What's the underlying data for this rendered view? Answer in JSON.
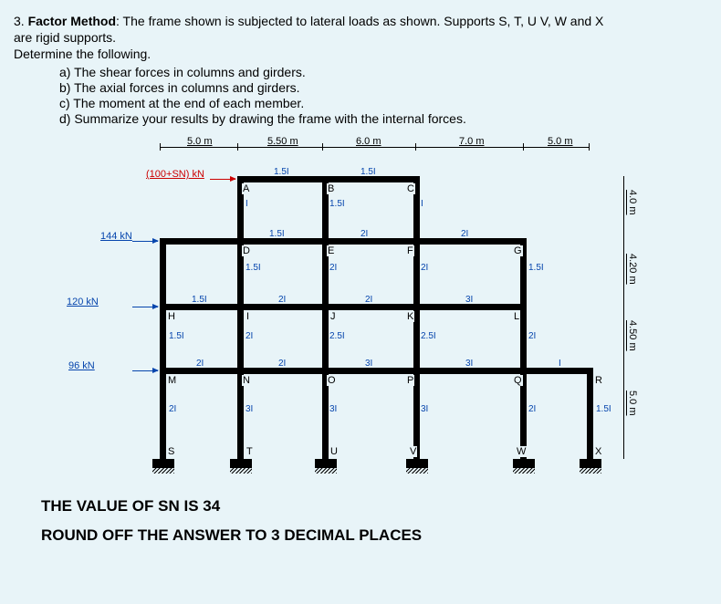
{
  "problem": {
    "number": "3.",
    "method": "Factor Method",
    "description": ": The frame shown is subjected to lateral loads as shown. Supports S, T, U V, W and X",
    "line2": "are rigid supports.",
    "line3": "Determine the following.",
    "items": {
      "a": "a)   The shear forces in columns and girders.",
      "b": "b)   The axial forces in columns and girders.",
      "c": "c)   The moment at the end of each member.",
      "d": "d)   Summarize your results by drawing the frame with the internal forces."
    }
  },
  "dims_top": {
    "d1": "5.0 m",
    "d2": "5.50 m",
    "d3": "6.0 m",
    "d4": "7.0 m",
    "d5": "5.0 m"
  },
  "dims_right": {
    "h1": "4.0 m",
    "h2": "4.20 m",
    "h3": "4.50 m",
    "h4": "5.0 m"
  },
  "loads": {
    "L1": "(100+SN) kN",
    "L2": "144 kN",
    "L3": "120 kN",
    "L4": "96 kN"
  },
  "nodes": {
    "A": "A",
    "B": "B",
    "C": "C",
    "D": "D",
    "E": "E",
    "F": "F",
    "G": "G",
    "H": "H",
    "I": "I",
    "J": "J",
    "K": "K",
    "L": "L",
    "M": "M",
    "N": "N",
    "O": "O",
    "P": "P",
    "Q": "Q",
    "R": "R",
    "S": "S",
    "T": "T",
    "U": "U",
    "V": "V",
    "W": "W",
    "X": "X"
  },
  "col_vals": {
    "v151": "1.5I",
    "v21": "2I",
    "v251": "2.5I",
    "v31": "3I",
    "v1": "I"
  },
  "footer": {
    "line1": "THE VALUE OF SN IS 34",
    "line2": "ROUND OFF THE ANSWER TO 3 DECIMAL PLACES"
  },
  "chart_data": {
    "type": "diagram",
    "description": "Structural frame with lateral loads",
    "bay_widths_m": [
      5.0,
      5.5,
      6.0,
      7.0,
      5.0
    ],
    "story_heights_m": [
      4.0,
      4.2,
      4.5,
      5.0
    ],
    "loads_kN": [
      {
        "label": "(100+SN)",
        "level": 1
      },
      {
        "value": 144,
        "level": 2
      },
      {
        "value": 120,
        "level": 3
      },
      {
        "value": 96,
        "level": 4
      }
    ],
    "supports": [
      "S",
      "T",
      "U",
      "V",
      "W",
      "X"
    ],
    "support_type": "rigid",
    "SN": 34,
    "member_I_girders": {
      "level1": [
        1.5,
        1.5
      ],
      "level2": [
        1.5,
        2,
        2
      ],
      "level3": [
        2,
        2,
        3
      ],
      "level4": [
        2,
        2,
        3,
        3,
        1
      ]
    },
    "member_I_columns_note": "See labels on diagram - varies 1.5I to 3I"
  }
}
